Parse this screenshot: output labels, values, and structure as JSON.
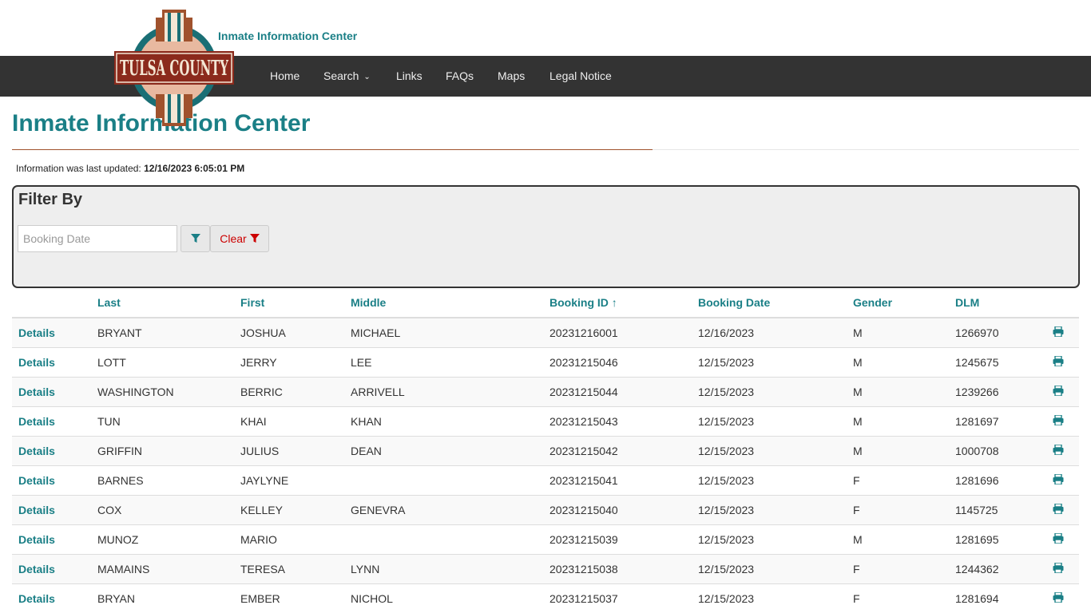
{
  "site": {
    "name": "Inmate Information Center",
    "logo_text": "TULSA COUNTY"
  },
  "nav": {
    "items": [
      {
        "label": "Home"
      },
      {
        "label": "Search"
      },
      {
        "label": "Links"
      },
      {
        "label": "FAQs"
      },
      {
        "label": "Maps"
      },
      {
        "label": "Legal Notice"
      }
    ]
  },
  "page": {
    "title": "Inmate Information Center",
    "updated_label": "Information was last updated:",
    "updated_value": "12/16/2023 6:05:01 PM"
  },
  "filter": {
    "title": "Filter By",
    "date_placeholder": "Booking Date",
    "clear_label": "Clear"
  },
  "table": {
    "headers": [
      "",
      "Last",
      "First",
      "Middle",
      "Booking ID ↑",
      "Booking Date",
      "Gender",
      "DLM",
      ""
    ],
    "details_label": "Details",
    "rows": [
      {
        "last": "BRYANT",
        "first": "JOSHUA",
        "middle": "MICHAEL",
        "booking_id": "20231216001",
        "booking_date": "12/16/2023",
        "gender": "M",
        "dlm": "1266970"
      },
      {
        "last": "LOTT",
        "first": "JERRY",
        "middle": "LEE",
        "booking_id": "20231215046",
        "booking_date": "12/15/2023",
        "gender": "M",
        "dlm": "1245675"
      },
      {
        "last": "WASHINGTON",
        "first": "BERRIC",
        "middle": "ARRIVELL",
        "booking_id": "20231215044",
        "booking_date": "12/15/2023",
        "gender": "M",
        "dlm": "1239266"
      },
      {
        "last": "TUN",
        "first": "KHAI",
        "middle": "KHAN",
        "booking_id": "20231215043",
        "booking_date": "12/15/2023",
        "gender": "M",
        "dlm": "1281697"
      },
      {
        "last": "GRIFFIN",
        "first": "JULIUS",
        "middle": "DEAN",
        "booking_id": "20231215042",
        "booking_date": "12/15/2023",
        "gender": "M",
        "dlm": "1000708"
      },
      {
        "last": "BARNES",
        "first": "JAYLYNE",
        "middle": "",
        "booking_id": "20231215041",
        "booking_date": "12/15/2023",
        "gender": "F",
        "dlm": "1281696"
      },
      {
        "last": "COX",
        "first": "KELLEY",
        "middle": "GENEVRA",
        "booking_id": "20231215040",
        "booking_date": "12/15/2023",
        "gender": "F",
        "dlm": "1145725"
      },
      {
        "last": "MUNOZ",
        "first": "MARIO",
        "middle": "",
        "booking_id": "20231215039",
        "booking_date": "12/15/2023",
        "gender": "M",
        "dlm": "1281695"
      },
      {
        "last": "MAMAINS",
        "first": "TERESA",
        "middle": "LYNN",
        "booking_id": "20231215038",
        "booking_date": "12/15/2023",
        "gender": "F",
        "dlm": "1244362"
      },
      {
        "last": "BRYAN",
        "first": "EMBER",
        "middle": "NICHOL",
        "booking_id": "20231215037",
        "booking_date": "12/15/2023",
        "gender": "F",
        "dlm": "1281694"
      }
    ]
  },
  "colors": {
    "accent": "#1a7f86",
    "navbar": "#333333",
    "clear": "#cc0000"
  }
}
